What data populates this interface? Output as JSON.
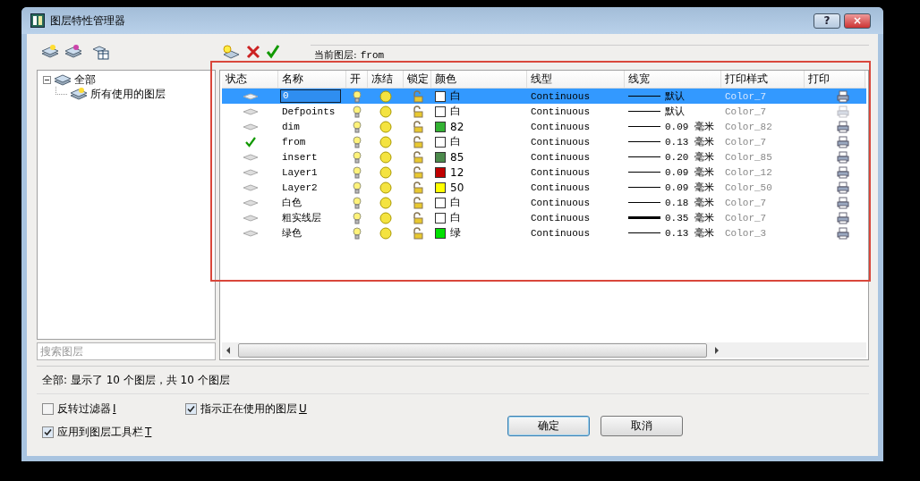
{
  "window": {
    "title": "图层特性管理器"
  },
  "title_buttons": [
    {
      "kind": "help",
      "label": "?"
    },
    {
      "kind": "close",
      "label": "×"
    }
  ],
  "current_layer": {
    "label": "当前图层:",
    "value": "from"
  },
  "filter_tree": [
    {
      "label": "全部",
      "expanded": true,
      "children": [
        {
          "label": "所有使用的图层"
        }
      ]
    }
  ],
  "search": {
    "placeholder": "搜索图层"
  },
  "table": {
    "columns": [
      "状态",
      "名称",
      "开",
      "冻结",
      "锁定",
      "颜色",
      "线型",
      "线宽",
      "打印样式",
      "打印"
    ],
    "rows": [
      {
        "kind": "layer",
        "name": "0",
        "on": true,
        "frozen": false,
        "locked": false,
        "color": "#ffffff",
        "color_label": "白",
        "linetype": "Continuous",
        "heavy": false,
        "lineweight": "默认",
        "plot_style": "Color_7",
        "plot": true,
        "selected": true
      },
      {
        "kind": "layer",
        "name": "Defpoints",
        "on": true,
        "frozen": false,
        "locked": false,
        "color": "#ffffff",
        "color_label": "白",
        "linetype": "Continuous",
        "heavy": false,
        "lineweight": "默认",
        "plot_style": "Color_7",
        "plot": false,
        "selected": false
      },
      {
        "kind": "layer",
        "name": "dim",
        "on": true,
        "frozen": false,
        "locked": false,
        "color": "#33b233",
        "color_label": "82",
        "linetype": "Continuous",
        "heavy": false,
        "lineweight": "0.09 毫米",
        "plot_style": "Color_82",
        "plot": true,
        "selected": false
      },
      {
        "kind": "current",
        "name": "from",
        "on": true,
        "frozen": false,
        "locked": false,
        "color": "#ffffff",
        "color_label": "白",
        "linetype": "Continuous",
        "heavy": false,
        "lineweight": "0.13 毫米",
        "plot_style": "Color_7",
        "plot": true,
        "selected": false
      },
      {
        "kind": "layer",
        "name": "insert",
        "on": true,
        "frozen": false,
        "locked": false,
        "color": "#4c8a4c",
        "color_label": "85",
        "linetype": "Continuous",
        "heavy": false,
        "lineweight": "0.20 毫米",
        "plot_style": "Color_85",
        "plot": true,
        "selected": false
      },
      {
        "kind": "layer",
        "name": "Layer1",
        "on": true,
        "frozen": false,
        "locked": false,
        "color": "#c00000",
        "color_label": "12",
        "linetype": "Continuous",
        "heavy": false,
        "lineweight": "0.09 毫米",
        "plot_style": "Color_12",
        "plot": true,
        "selected": false
      },
      {
        "kind": "layer",
        "name": "Layer2",
        "on": true,
        "frozen": false,
        "locked": false,
        "color": "#ffff00",
        "color_label": "50",
        "linetype": "Continuous",
        "heavy": false,
        "lineweight": "0.09 毫米",
        "plot_style": "Color_50",
        "plot": true,
        "selected": false
      },
      {
        "kind": "layer",
        "name": "白色",
        "on": true,
        "frozen": false,
        "locked": false,
        "color": "#ffffff",
        "color_label": "白",
        "linetype": "Continuous",
        "heavy": false,
        "lineweight": "0.18 毫米",
        "plot_style": "Color_7",
        "plot": true,
        "selected": false
      },
      {
        "kind": "layer",
        "name": "粗实线层",
        "on": true,
        "frozen": false,
        "locked": false,
        "color": "#ffffff",
        "color_label": "白",
        "linetype": "Continuous",
        "heavy": true,
        "lineweight": "0.35 毫米",
        "plot_style": "Color_7",
        "plot": true,
        "selected": false
      },
      {
        "kind": "layer",
        "name": "绿色",
        "on": true,
        "frozen": false,
        "locked": false,
        "color": "#00e000",
        "color_label": "绿",
        "linetype": "Continuous",
        "heavy": false,
        "lineweight": "0.13 毫米",
        "plot_style": "Color_3",
        "plot": true,
        "selected": false
      }
    ]
  },
  "status_bar": "全部: 显示了 10 个图层，共 10 个图层",
  "options": [
    {
      "label": "反转过滤器",
      "key": "I",
      "checked": false
    },
    {
      "label": "指示正在使用的图层",
      "key": "U",
      "checked": true
    },
    {
      "label": "应用到图层工具栏",
      "key": "T",
      "checked": true
    }
  ],
  "buttons": [
    {
      "label": "确定",
      "default": true
    },
    {
      "label": "取消",
      "default": false
    }
  ]
}
